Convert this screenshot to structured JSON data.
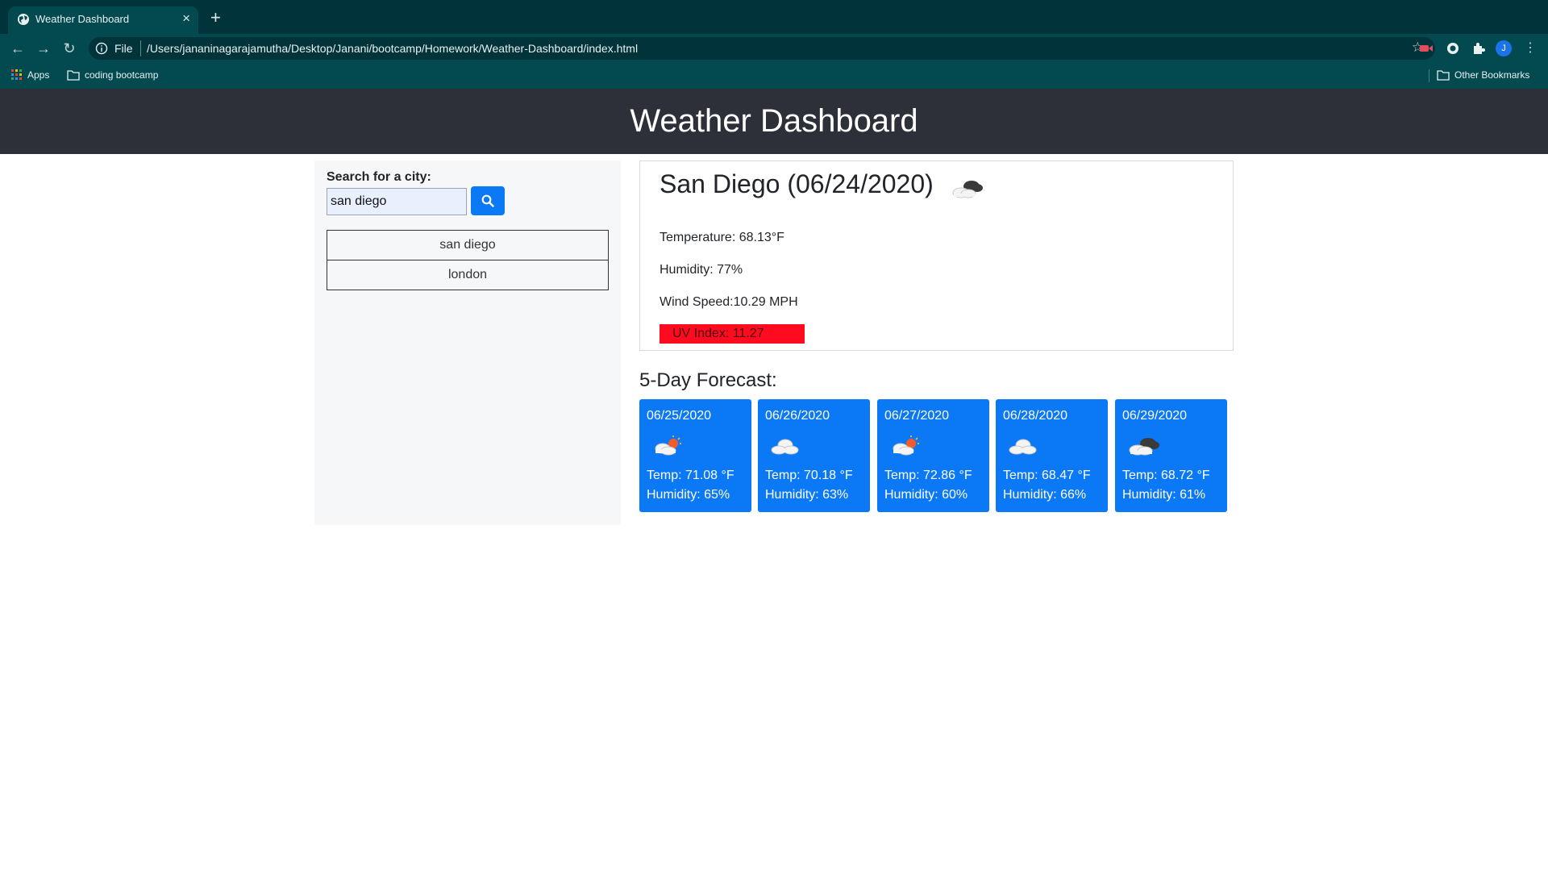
{
  "browser": {
    "tab_title": "Weather Dashboard",
    "url_scheme": "File",
    "url": "/Users/jananinagarajamutha/Desktop/Janani/bootcamp/Homework/Weather-Dashboard/index.html",
    "bookmarks": {
      "apps": "Apps",
      "folder": "coding bootcamp",
      "other": "Other Bookmarks"
    },
    "avatar_letter": "J"
  },
  "header": {
    "title": "Weather Dashboard"
  },
  "search": {
    "label": "Search for a city:",
    "value": "san diego"
  },
  "history": [
    "san diego",
    "london"
  ],
  "current": {
    "heading": "San Diego (06/24/2020)",
    "icon": "dark-cloud-icon",
    "temperature": "Temperature: 68.13°F",
    "humidity": "Humidity: 77%",
    "wind": "Wind Speed:10.29 MPH",
    "uv": "UV Index: 11.27",
    "uv_color": "#ff0b1f"
  },
  "forecast": {
    "title": "5-Day Forecast:",
    "accent": "#0b78f5",
    "days": [
      {
        "date": "06/25/2020",
        "icon": "sun-cloud-icon",
        "temp": "Temp: 71.08 °F",
        "humidity": "Humidity: 65%"
      },
      {
        "date": "06/26/2020",
        "icon": "cloud-icon",
        "temp": "Temp: 70.18 °F",
        "humidity": "Humidity: 63%"
      },
      {
        "date": "06/27/2020",
        "icon": "sun-cloud-icon",
        "temp": "Temp: 72.86 °F",
        "humidity": "Humidity: 60%"
      },
      {
        "date": "06/28/2020",
        "icon": "cloud-icon",
        "temp": "Temp: 68.47 °F",
        "humidity": "Humidity: 66%"
      },
      {
        "date": "06/29/2020",
        "icon": "dark-cloud-icon",
        "temp": "Temp: 68.72 °F",
        "humidity": "Humidity: 61%"
      }
    ]
  }
}
